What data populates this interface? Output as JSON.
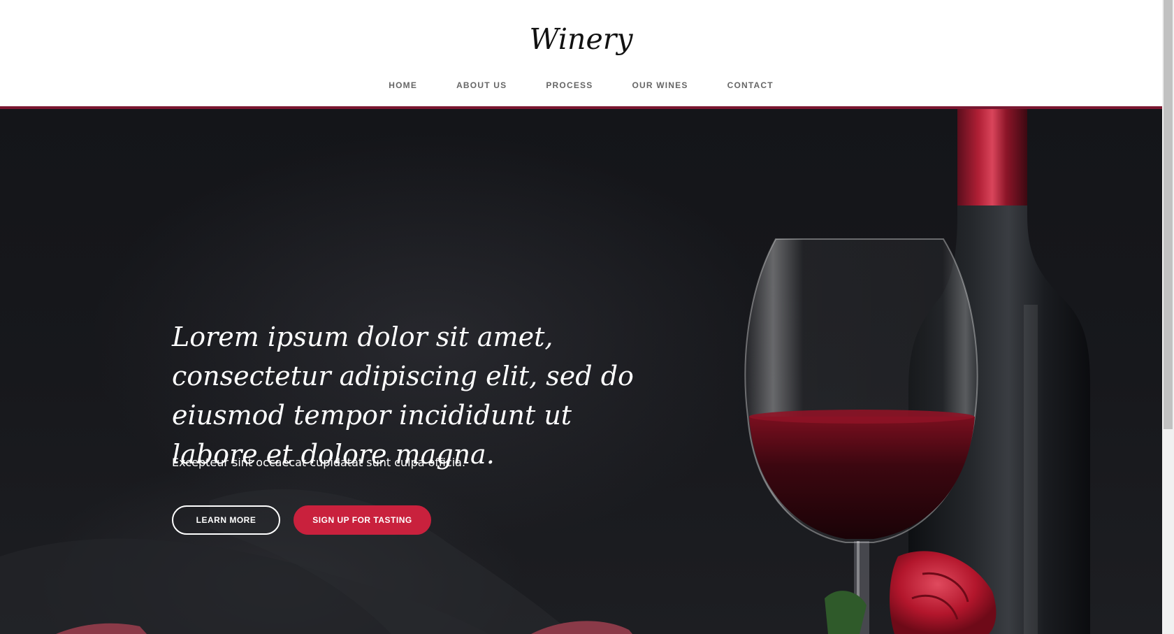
{
  "header": {
    "brand": "Winery",
    "nav": [
      {
        "label": "HOME"
      },
      {
        "label": "ABOUT US"
      },
      {
        "label": "PROCESS"
      },
      {
        "label": "OUR WINES"
      },
      {
        "label": "CONTACT"
      }
    ],
    "accent_color": "#7a1730"
  },
  "hero": {
    "heading": "Lorem ipsum dolor sit amet, consectetur adipiscing elit, sed do eiusmod tempor incididunt ut labore et dolore magna.",
    "subtext": "Excepteur sint occaecat cupidatat sunt culpa officia.",
    "buttons": {
      "learn_more": "LEARN MORE",
      "sign_up": "SIGN UP FOR TASTING"
    },
    "button_color": "#c9213d"
  }
}
